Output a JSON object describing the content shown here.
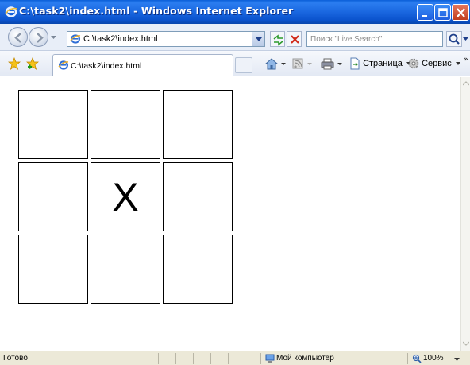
{
  "window": {
    "title": "C:\\task2\\index.html - Windows Internet Explorer"
  },
  "address_bar": {
    "url": "C:\\task2\\index.html"
  },
  "search": {
    "placeholder": "Поиск \"Live Search\""
  },
  "tab": {
    "label": "C:\\task2\\index.html"
  },
  "command_bar": {
    "page_label": "Страница",
    "tools_label": "Сервис",
    "overflow": "»"
  },
  "board": {
    "cells": [
      "",
      "",
      "",
      "",
      "X",
      "",
      "",
      "",
      ""
    ]
  },
  "status_bar": {
    "status": "Готово",
    "zone": "Мой компьютер",
    "zoom": "100%"
  },
  "colors": {
    "titlebar": "#1a67e0",
    "close_button": "#c23e1e",
    "status_bar": "#ece9d8"
  }
}
